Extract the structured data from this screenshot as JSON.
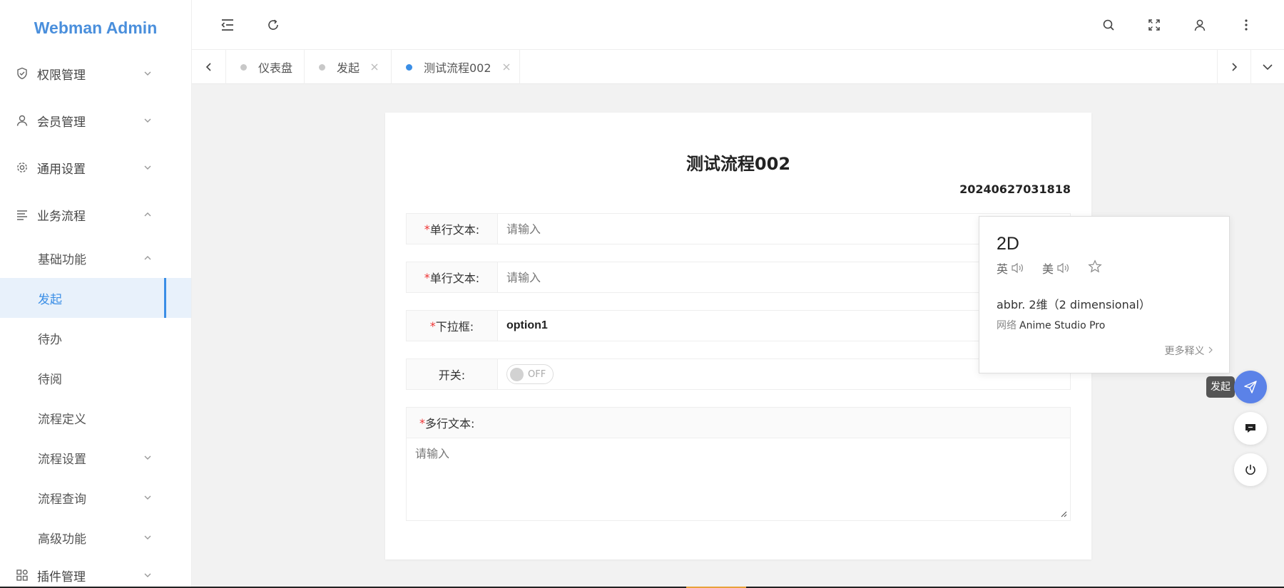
{
  "app": {
    "title": "Webman Admin"
  },
  "sidebar": {
    "items": [
      {
        "label": "权限管理",
        "icon": "shield-icon"
      },
      {
        "label": "会员管理",
        "icon": "user-icon"
      },
      {
        "label": "通用设置",
        "icon": "gear-icon"
      },
      {
        "label": "业务流程",
        "icon": "list-icon"
      }
    ],
    "sub": {
      "group": "基础功能",
      "items": [
        "发起",
        "待办",
        "待阅",
        "流程定义"
      ],
      "more": [
        "流程设置",
        "流程查询",
        "高级功能"
      ]
    },
    "plugin": {
      "label": "插件管理",
      "icon": "grid-icon"
    }
  },
  "tabs": [
    {
      "label": "仪表盘"
    },
    {
      "label": "发起"
    },
    {
      "label": "测试流程002"
    }
  ],
  "form": {
    "title": "测试流程002",
    "serial": "20240627031818",
    "fields": {
      "text1_label": "单行文本:",
      "text2_label": "单行文本:",
      "select_label": "下拉框:",
      "select_value": "option1",
      "switch_label": "开关:",
      "switch_state": "OFF",
      "textarea_label": "多行文本:",
      "placeholder": "请输入"
    }
  },
  "popup": {
    "word": "2D",
    "pron_uk": "英",
    "pron_us": "美",
    "definition": "abbr. 2维（2 dimensional）",
    "net_label": "网络",
    "net_value": "Anime Studio Pro",
    "more": "更多释义"
  },
  "fab": {
    "tooltip": "发起"
  },
  "colors": {
    "accent": "#3a8ee6",
    "logo": "#4a8fdc",
    "fab": "#5b82e8",
    "required": "#e33333"
  }
}
